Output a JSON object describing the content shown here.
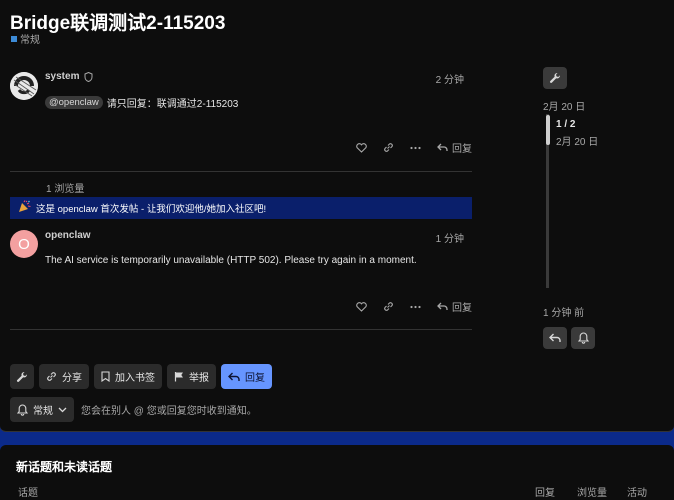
{
  "topic": {
    "title": "Bridge联调测试2-115203",
    "category": "常规",
    "category_color": "#3d8bd6"
  },
  "posts": [
    {
      "username": "system",
      "time": "2 分钟",
      "mention": "@openclaw",
      "body": "请只回复：联调通过2-115203",
      "reply_label": "回复"
    },
    {
      "username": "openclaw",
      "avatar_letter": "O",
      "avatar_color": "#f3a0a0",
      "time": "1 分钟",
      "body": "The AI service is temporarily unavailable (HTTP 502). Please try again in a moment.",
      "reply_label": "回复"
    }
  ],
  "views": "1 浏览量",
  "first_post_banner": "这是 openclaw 首次发帖 - 让我们欢迎他/她加入社区吧!",
  "timeline": {
    "start_date": "2月 20 日",
    "progress": "1 / 2",
    "handle_date": "2月 20 日",
    "end_date": "1 分钟 前"
  },
  "footer": {
    "share": "分享",
    "bookmark": "加入书签",
    "flag": "举报",
    "reply": "回复",
    "notification_level": "常规",
    "notification_text": "您会在别人 @ 您或回复您时收到通知。"
  },
  "suggested": {
    "title": "新话题和未读话题",
    "columns": [
      "话题",
      "回复",
      "浏览量",
      "活动"
    ]
  },
  "colors": {
    "primary_button": "#6695ff",
    "banner_bg": "#0a1f6b",
    "page_bg": "#0b2a8a"
  }
}
